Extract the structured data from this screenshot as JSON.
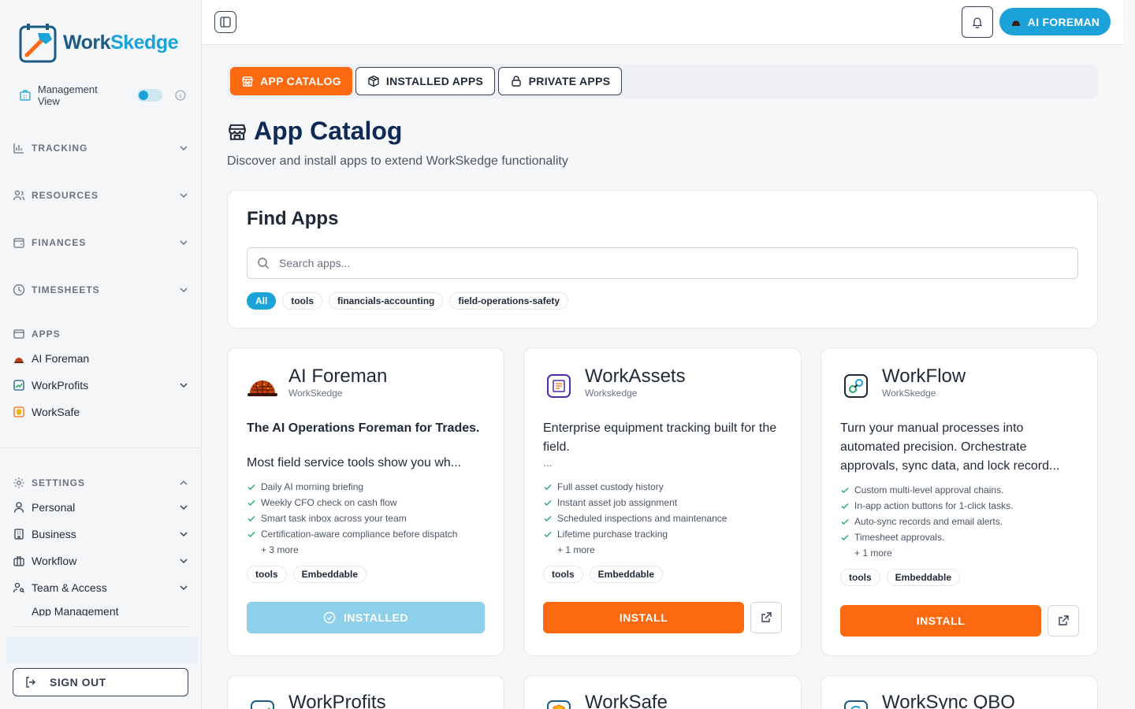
{
  "brand": {
    "name_part1": "Work",
    "name_part2": "Skedge",
    "accent": "#1ba3d9",
    "orange": "#fb6a10"
  },
  "sidebar": {
    "management_view": "Management View",
    "management_toggle": "on",
    "sections": {
      "tracking": "TRACKING",
      "resources": "RESOURCES",
      "finances": "FINANCES",
      "timesheets": "TIMESHEETS",
      "apps": "APPS",
      "settings": "SETTINGS"
    },
    "apps_items": [
      "AI Foreman",
      "WorkProfits",
      "WorkSafe"
    ],
    "settings_items": [
      "Personal",
      "Business",
      "Workflow",
      "Team & Access"
    ],
    "partial_item": "App Management",
    "sign_out": "SIGN OUT"
  },
  "topbar": {
    "ai_foreman_button": "AI FOREMAN"
  },
  "tabs": {
    "catalog": "APP CATALOG",
    "installed": "INSTALLED APPS",
    "private": "PRIVATE APPS"
  },
  "page": {
    "title": "App Catalog",
    "subtitle": "Discover and install apps to extend WorkSkedge functionality"
  },
  "find": {
    "title": "Find Apps",
    "search_placeholder": "Search apps...",
    "search_value": "",
    "filters": [
      "All",
      "tools",
      "financials-accounting",
      "field-operations-safety"
    ],
    "active_filter": "All"
  },
  "apps": [
    {
      "name": "AI Foreman",
      "vendor": "WorkSkedge",
      "desc_bold": "The AI Operations Foreman for Trades.",
      "desc": "Most field service tools show you wh...",
      "features": [
        "Daily AI morning briefing",
        "Weekly CFO check on cash flow",
        "Smart task inbox across your team",
        "Certification-aware compliance before dispatch"
      ],
      "more": "+ 3 more",
      "tags": [
        "tools",
        "Embeddable"
      ],
      "action": "INSTALLED"
    },
    {
      "name": "WorkAssets",
      "vendor": "Workskedge",
      "desc": "Enterprise equipment tracking built for the field.",
      "desc_more": "...",
      "features": [
        "Full asset custody history",
        "Instant asset job assignment",
        "Scheduled inspections and maintenance",
        "Lifetime purchase tracking"
      ],
      "more": "+ 1 more",
      "tags": [
        "tools",
        "Embeddable"
      ],
      "action": "INSTALL"
    },
    {
      "name": "WorkFlow",
      "vendor": "WorkSkedge",
      "desc_bold": "Turn your manual processes into automated precision. Orchestrate approvals, sync data, and lock record...",
      "features": [
        "Custom multi-level approval chains.",
        "In-app action buttons for 1-click tasks.",
        "Auto-sync records and email alerts.",
        "Timesheet approvals."
      ],
      "more": "+ 1 more",
      "tags": [
        "tools",
        "Embeddable"
      ],
      "action": "INSTALL"
    },
    {
      "name": "WorkProfits"
    },
    {
      "name": "WorkSafe"
    },
    {
      "name": "WorkSync QBO"
    }
  ]
}
